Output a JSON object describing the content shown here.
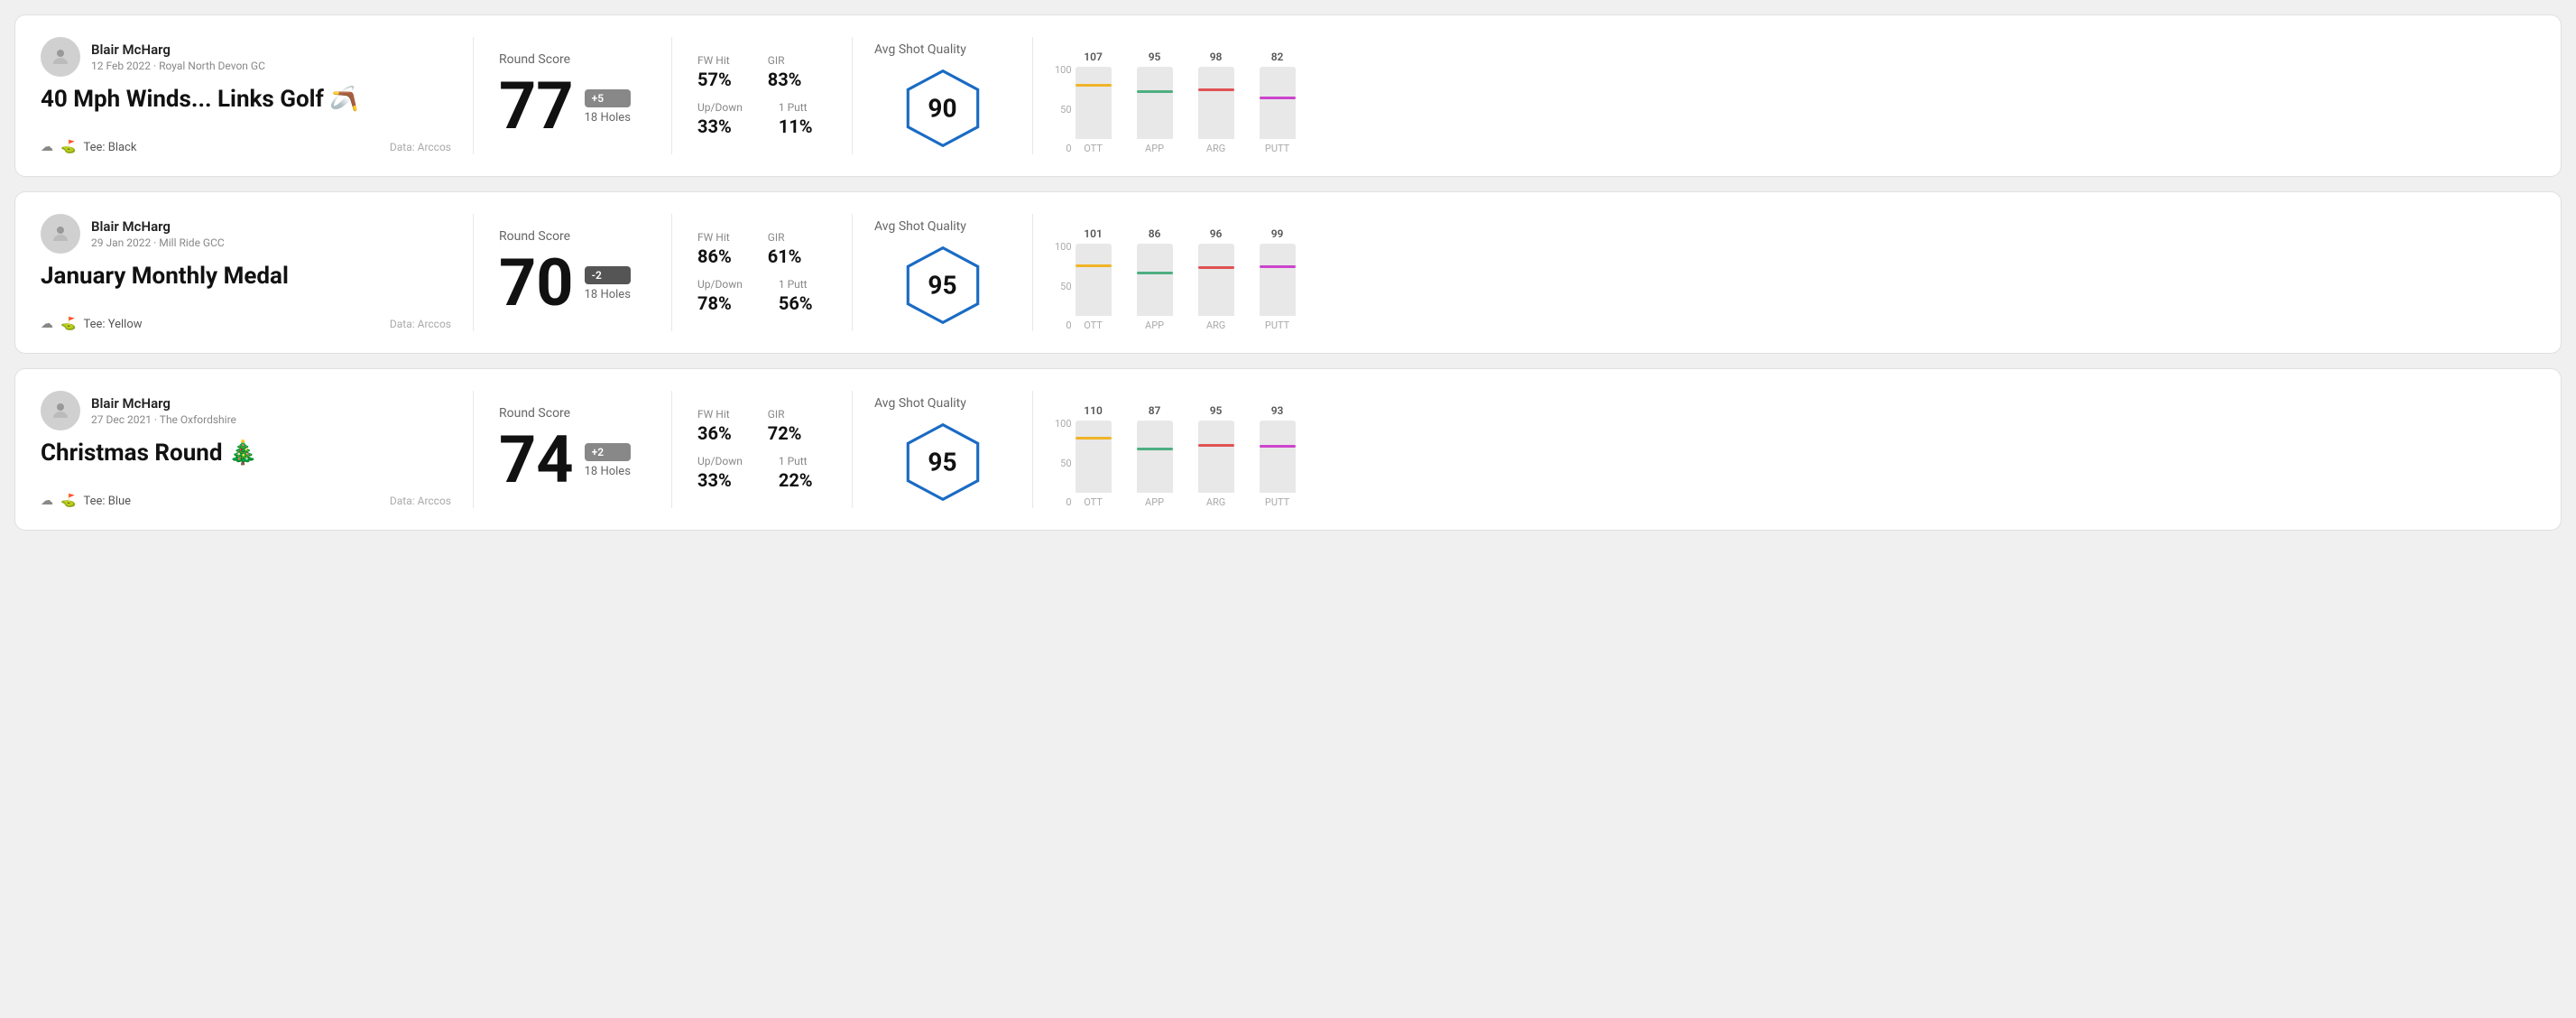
{
  "rounds": [
    {
      "user": {
        "name": "Blair McHarg",
        "date_venue": "12 Feb 2022 · Royal North Devon GC"
      },
      "title": "40 Mph Winds... Links Golf 🪃",
      "tee": "Black",
      "data_source": "Data: Arccos",
      "round_score_label": "Round Score",
      "score": "77",
      "badge": "+5",
      "badge_type": "positive",
      "holes": "18 Holes",
      "fw_hit_label": "FW Hit",
      "fw_hit": "57%",
      "gir_label": "GIR",
      "gir": "83%",
      "updown_label": "Up/Down",
      "updown": "33%",
      "oneputt_label": "1 Putt",
      "oneputt": "11%",
      "avg_shot_quality_label": "Avg Shot Quality",
      "quality_score": "90",
      "chart": {
        "bars": [
          {
            "label": "OTT",
            "value": 107,
            "color_class": "ott-line",
            "height_pct": 72
          },
          {
            "label": "APP",
            "value": 95,
            "color_class": "app-line",
            "height_pct": 64
          },
          {
            "label": "ARG",
            "value": 98,
            "color_class": "arg-line",
            "height_pct": 66
          },
          {
            "label": "PUTT",
            "value": 82,
            "color_class": "putt-line",
            "height_pct": 55
          }
        ],
        "y_labels": [
          "100",
          "50",
          "0"
        ]
      }
    },
    {
      "user": {
        "name": "Blair McHarg",
        "date_venue": "29 Jan 2022 · Mill Ride GCC"
      },
      "title": "January Monthly Medal",
      "tee": "Yellow",
      "data_source": "Data: Arccos",
      "round_score_label": "Round Score",
      "score": "70",
      "badge": "-2",
      "badge_type": "negative",
      "holes": "18 Holes",
      "fw_hit_label": "FW Hit",
      "fw_hit": "86%",
      "gir_label": "GIR",
      "gir": "61%",
      "updown_label": "Up/Down",
      "updown": "78%",
      "oneputt_label": "1 Putt",
      "oneputt": "56%",
      "avg_shot_quality_label": "Avg Shot Quality",
      "quality_score": "95",
      "chart": {
        "bars": [
          {
            "label": "OTT",
            "value": 101,
            "color_class": "ott-line",
            "height_pct": 68
          },
          {
            "label": "APP",
            "value": 86,
            "color_class": "app-line",
            "height_pct": 58
          },
          {
            "label": "ARG",
            "value": 96,
            "color_class": "arg-line",
            "height_pct": 65
          },
          {
            "label": "PUTT",
            "value": 99,
            "color_class": "putt-line",
            "height_pct": 66
          }
        ],
        "y_labels": [
          "100",
          "50",
          "0"
        ]
      }
    },
    {
      "user": {
        "name": "Blair McHarg",
        "date_venue": "27 Dec 2021 · The Oxfordshire"
      },
      "title": "Christmas Round 🎄",
      "tee": "Blue",
      "data_source": "Data: Arccos",
      "round_score_label": "Round Score",
      "score": "74",
      "badge": "+2",
      "badge_type": "positive",
      "holes": "18 Holes",
      "fw_hit_label": "FW Hit",
      "fw_hit": "36%",
      "gir_label": "GIR",
      "gir": "72%",
      "updown_label": "Up/Down",
      "updown": "33%",
      "oneputt_label": "1 Putt",
      "oneputt": "22%",
      "avg_shot_quality_label": "Avg Shot Quality",
      "quality_score": "95",
      "chart": {
        "bars": [
          {
            "label": "OTT",
            "value": 110,
            "color_class": "ott-line",
            "height_pct": 74
          },
          {
            "label": "APP",
            "value": 87,
            "color_class": "app-line",
            "height_pct": 59
          },
          {
            "label": "ARG",
            "value": 95,
            "color_class": "arg-line",
            "height_pct": 64
          },
          {
            "label": "PUTT",
            "value": 93,
            "color_class": "putt-line",
            "height_pct": 63
          }
        ],
        "y_labels": [
          "100",
          "50",
          "0"
        ]
      }
    }
  ]
}
